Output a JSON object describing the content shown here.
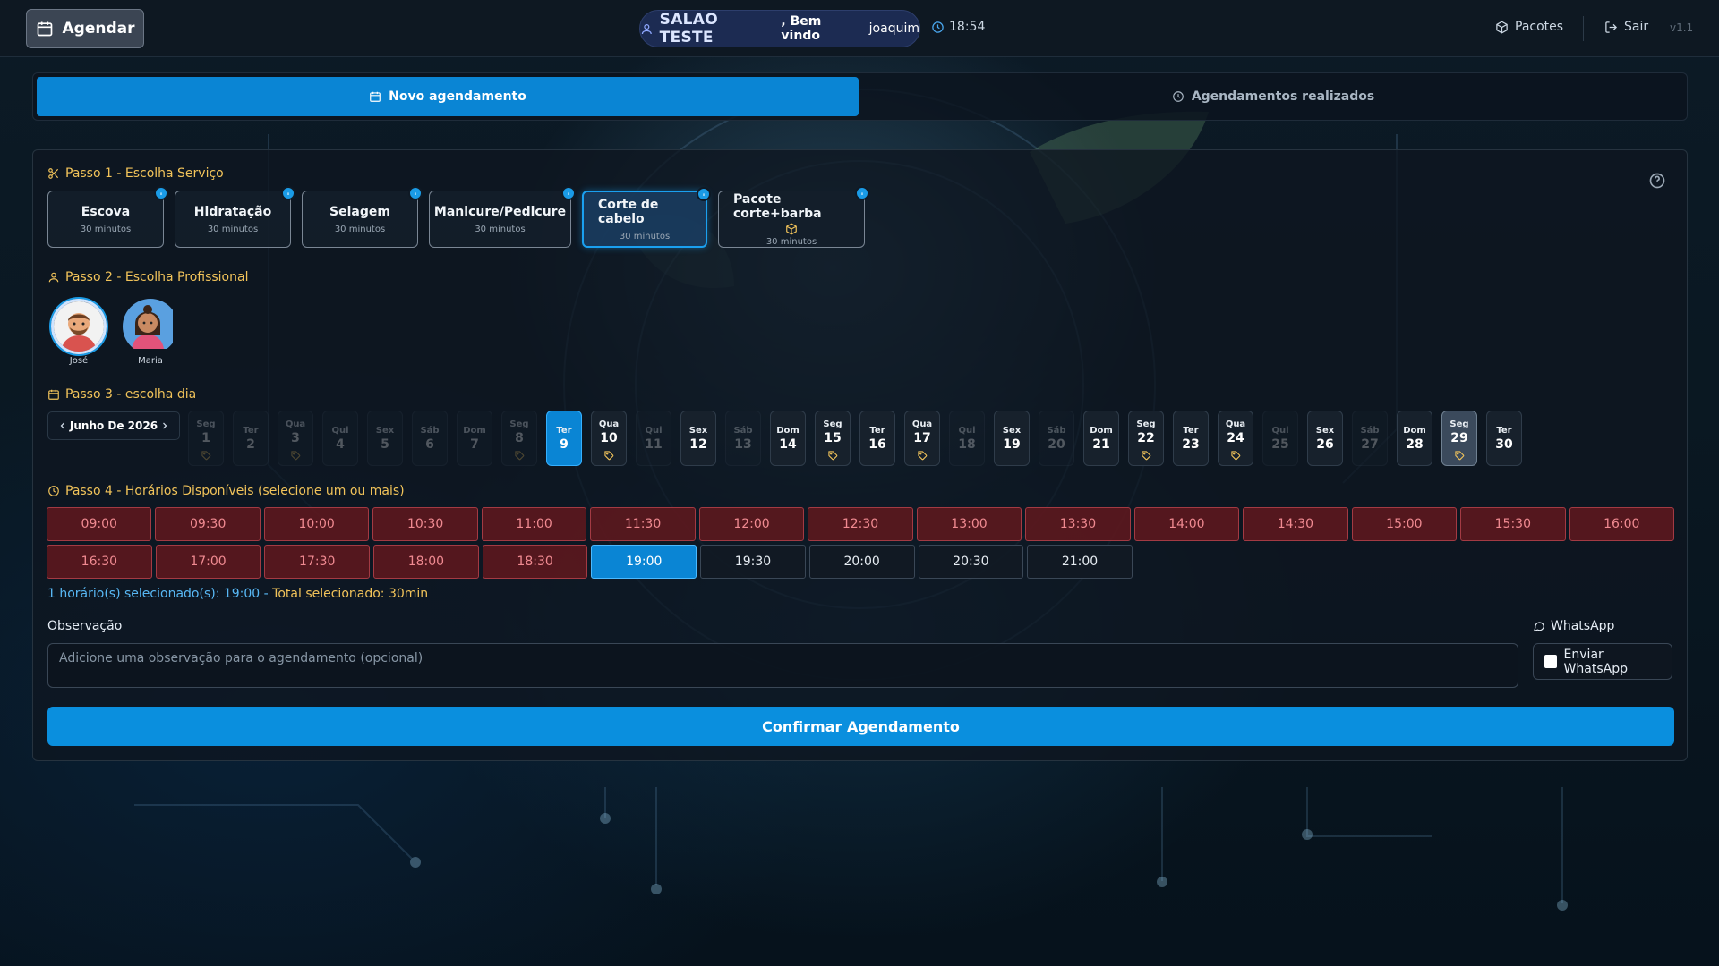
{
  "header": {
    "agendar_label": "Agendar",
    "salon_name": "SALAO TESTE",
    "welcome_prefix": ", Bem vindo",
    "user_name": "joaquim",
    "time": "18:54",
    "pacotes_label": "Pacotes",
    "sair_label": "Sair",
    "version": "v1.1"
  },
  "tabs": [
    {
      "label": "Novo agendamento",
      "active": true
    },
    {
      "label": "Agendamentos realizados",
      "active": false
    }
  ],
  "step1": {
    "title": "Passo 1 - Escolha Serviço",
    "services": [
      {
        "name": "Escova",
        "duration": "30 minutos",
        "selected": false,
        "package": false
      },
      {
        "name": "Hidratação",
        "duration": "30 minutos",
        "selected": false,
        "package": false
      },
      {
        "name": "Selagem",
        "duration": "30 minutos",
        "selected": false,
        "package": false
      },
      {
        "name": "Manicure/Pedicure",
        "duration": "30 minutos",
        "selected": false,
        "package": false
      },
      {
        "name": "Corte de cabelo",
        "duration": "30 minutos",
        "selected": true,
        "package": false
      },
      {
        "name": "Pacote corte+barba",
        "duration": "30 minutos",
        "selected": false,
        "package": true
      }
    ]
  },
  "step2": {
    "title": "Passo 2 - Escolha Profissional",
    "professionals": [
      {
        "name": "José",
        "selected": true
      },
      {
        "name": "Maria",
        "selected": false
      }
    ]
  },
  "step3": {
    "title": "Passo 3 - escolha dia",
    "month_label": "Junho De 2026",
    "days": [
      {
        "dow": "Seg",
        "day": "1",
        "disabled": true,
        "tag": true
      },
      {
        "dow": "Ter",
        "day": "2",
        "disabled": true,
        "tag": false
      },
      {
        "dow": "Qua",
        "day": "3",
        "disabled": true,
        "tag": true
      },
      {
        "dow": "Qui",
        "day": "4",
        "disabled": true,
        "tag": false
      },
      {
        "dow": "Sex",
        "day": "5",
        "disabled": true,
        "tag": false
      },
      {
        "dow": "Sáb",
        "day": "6",
        "disabled": true,
        "tag": false
      },
      {
        "dow": "Dom",
        "day": "7",
        "disabled": true,
        "tag": false
      },
      {
        "dow": "Seg",
        "day": "8",
        "disabled": true,
        "tag": true
      },
      {
        "dow": "Ter",
        "day": "9",
        "disabled": false,
        "tag": false,
        "state": "today"
      },
      {
        "dow": "Qua",
        "day": "10",
        "disabled": false,
        "tag": true
      },
      {
        "dow": "Qui",
        "day": "11",
        "disabled": true,
        "tag": false
      },
      {
        "dow": "Sex",
        "day": "12",
        "disabled": false,
        "tag": false
      },
      {
        "dow": "Sáb",
        "day": "13",
        "disabled": true,
        "tag": false
      },
      {
        "dow": "Dom",
        "day": "14",
        "disabled": false,
        "tag": false
      },
      {
        "dow": "Seg",
        "day": "15",
        "disabled": false,
        "tag": true
      },
      {
        "dow": "Ter",
        "day": "16",
        "disabled": false,
        "tag": false
      },
      {
        "dow": "Qua",
        "day": "17",
        "disabled": false,
        "tag": true
      },
      {
        "dow": "Qui",
        "day": "18",
        "disabled": true,
        "tag": false
      },
      {
        "dow": "Sex",
        "day": "19",
        "disabled": false,
        "tag": false
      },
      {
        "dow": "Sáb",
        "day": "20",
        "disabled": true,
        "tag": false
      },
      {
        "dow": "Dom",
        "day": "21",
        "disabled": false,
        "tag": false
      },
      {
        "dow": "Seg",
        "day": "22",
        "disabled": false,
        "tag": true
      },
      {
        "dow": "Ter",
        "day": "23",
        "disabled": false,
        "tag": false
      },
      {
        "dow": "Qua",
        "day": "24",
        "disabled": false,
        "tag": true
      },
      {
        "dow": "Qui",
        "day": "25",
        "disabled": true,
        "tag": false
      },
      {
        "dow": "Sex",
        "day": "26",
        "disabled": false,
        "tag": false
      },
      {
        "dow": "Sáb",
        "day": "27",
        "disabled": true,
        "tag": false
      },
      {
        "dow": "Dom",
        "day": "28",
        "disabled": false,
        "tag": false
      },
      {
        "dow": "Seg",
        "day": "29",
        "disabled": false,
        "tag": true,
        "state": "highlight"
      },
      {
        "dow": "Ter",
        "day": "30",
        "disabled": false,
        "tag": false
      }
    ]
  },
  "step4": {
    "title": "Passo 4 - Horários Disponíveis (selecione um ou mais)",
    "slots": [
      {
        "time": "09:00",
        "status": "busy"
      },
      {
        "time": "09:30",
        "status": "busy"
      },
      {
        "time": "10:00",
        "status": "busy"
      },
      {
        "time": "10:30",
        "status": "busy"
      },
      {
        "time": "11:00",
        "status": "busy"
      },
      {
        "time": "11:30",
        "status": "busy"
      },
      {
        "time": "12:00",
        "status": "busy"
      },
      {
        "time": "12:30",
        "status": "busy"
      },
      {
        "time": "13:00",
        "status": "busy"
      },
      {
        "time": "13:30",
        "status": "busy"
      },
      {
        "time": "14:00",
        "status": "busy"
      },
      {
        "time": "14:30",
        "status": "busy"
      },
      {
        "time": "15:00",
        "status": "busy"
      },
      {
        "time": "15:30",
        "status": "busy"
      },
      {
        "time": "16:00",
        "status": "busy"
      },
      {
        "time": "16:30",
        "status": "busy"
      },
      {
        "time": "17:00",
        "status": "busy"
      },
      {
        "time": "17:30",
        "status": "busy"
      },
      {
        "time": "18:00",
        "status": "busy"
      },
      {
        "time": "18:30",
        "status": "busy"
      },
      {
        "time": "19:00",
        "status": "selected"
      },
      {
        "time": "19:30",
        "status": "free"
      },
      {
        "time": "20:00",
        "status": "free"
      },
      {
        "time": "20:30",
        "status": "free"
      },
      {
        "time": "21:00",
        "status": "free"
      }
    ],
    "summary_selected": "1 horário(s) selecionado(s): 19:00 -",
    "summary_total": "Total selecionado: 30min"
  },
  "observacao": {
    "label": "Observação",
    "placeholder": "Adicione uma observação para o agendamento (opcional)"
  },
  "whatsapp": {
    "label": "WhatsApp",
    "checkbox_label": "Enviar WhatsApp",
    "checked": false
  },
  "confirm_label": "Confirmar Agendamento",
  "colors": {
    "primary": "#0a85d4",
    "accent_title": "#f1c35a",
    "busy_bg": "#5f181e",
    "busy_text": "#f08a91"
  }
}
